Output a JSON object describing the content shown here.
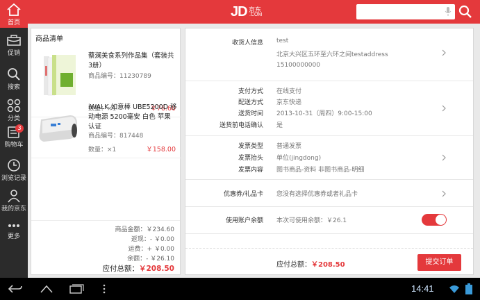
{
  "brand": {
    "logo": "JD",
    "cn": "京东",
    "com": ".COM",
    "color": "#e4393c"
  },
  "search": {
    "placeholder": "",
    "value": ""
  },
  "nav": [
    {
      "label": "首页",
      "icon": "home-icon"
    },
    {
      "label": "促销",
      "icon": "promo-icon"
    },
    {
      "label": "搜索",
      "icon": "search-icon"
    },
    {
      "label": "分类",
      "icon": "category-icon"
    },
    {
      "label": "购物车",
      "icon": "cart-icon",
      "badge": "3"
    },
    {
      "label": "浏览记录",
      "icon": "history-icon"
    },
    {
      "label": "我的京东",
      "icon": "user-icon"
    },
    {
      "label": "更多",
      "icon": "more-icon"
    }
  ],
  "cart": {
    "title": "商品清单",
    "items": [
      {
        "name": "蔡澜美食系列作品集（套装共3册）",
        "code": "商品编号：11230789",
        "qty": "数量：×1",
        "price": "￥76.60"
      },
      {
        "name": "iWALK 如意棒 UBE5200D 移动电源 5200毫安 白色 苹果认证",
        "code": "商品编号：817448",
        "qty": "数量：×1",
        "price": "￥158.00"
      }
    ],
    "summary": [
      {
        "label": "商品金额：",
        "value": "￥234.60"
      },
      {
        "label": "返现：",
        "value": "- ￥0.00"
      },
      {
        "label": "运费：",
        "value": "+ ￥0.00"
      },
      {
        "label": "余额：",
        "value": "- ￥26.10"
      }
    ],
    "total_label": "应付总额：",
    "total_value": "￥208.50"
  },
  "order": {
    "receiver": {
      "label": "收货人信息",
      "name": "test",
      "address": "北京大兴区五环至六环之间testaddress",
      "phone": "15100000000"
    },
    "delivery": [
      {
        "label": "支付方式",
        "value": "在线支付"
      },
      {
        "label": "配送方式",
        "value": "京东快递"
      },
      {
        "label": "送货时间",
        "value": "2013-10-31（周四）9:00-15:00"
      },
      {
        "label": "送货前电话确认",
        "value": "是"
      }
    ],
    "invoice": [
      {
        "label": "发票类型",
        "value": "普通发票"
      },
      {
        "label": "发票抬头",
        "value": "单位(jingdong)"
      },
      {
        "label": "发票内容",
        "value": "图书商品-资料 非图书商品-明细"
      }
    ],
    "coupon": {
      "label": "优惠券/礼品卡",
      "value": "您没有选择优惠券或者礼品卡"
    },
    "balance": {
      "label": "使用账户余额",
      "value": "本次可使用余额：￥26.1",
      "on": true
    },
    "footer": {
      "total_label": "应付总额：",
      "total_value": "￥208.50",
      "submit": "提交订单"
    }
  },
  "system": {
    "clock": "14:41"
  }
}
